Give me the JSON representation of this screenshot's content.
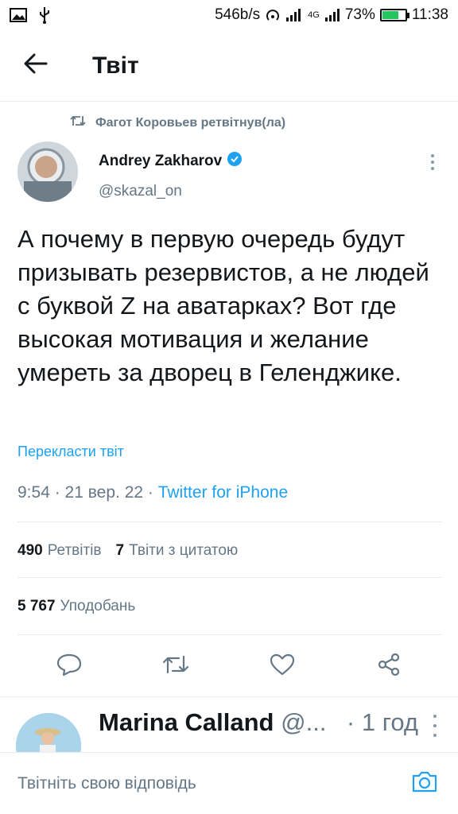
{
  "status_bar": {
    "speed": "546b/s",
    "network": "4G",
    "battery_percent": "73%",
    "battery_level": 0.73,
    "time": "11:38"
  },
  "header": {
    "title": "Твіт"
  },
  "retweet": {
    "text": "Фагот Коровьев ретвітнув(ла)"
  },
  "tweet": {
    "author_name": "Andrey Zakharov",
    "handle": "@skazal_on",
    "verified": true,
    "text": "А почему в первую очередь будут призывать резервистов, а не людей с буквой Z на аватарках? Вот где высокая мотивация и желание умереть за дворец в Геленджике.",
    "translate_label": "Перекласти твіт",
    "time": "9:54",
    "date": "21 вер. 22",
    "source": "Twitter for iPhone",
    "retweets_count": "490",
    "retweets_label": "Ретвітів",
    "quotes_count": "7",
    "quotes_label": "Твіти з цитатою",
    "likes_count": "5 767",
    "likes_label": "Уподобань"
  },
  "reply_preview": {
    "name": "Marina Calland",
    "handle": "@...",
    "time": "· 1 год"
  },
  "compose": {
    "placeholder": "Твітніть свою відповідь"
  },
  "colors": {
    "accent": "#1da1f2",
    "muted": "#657786",
    "text": "#14171a"
  }
}
